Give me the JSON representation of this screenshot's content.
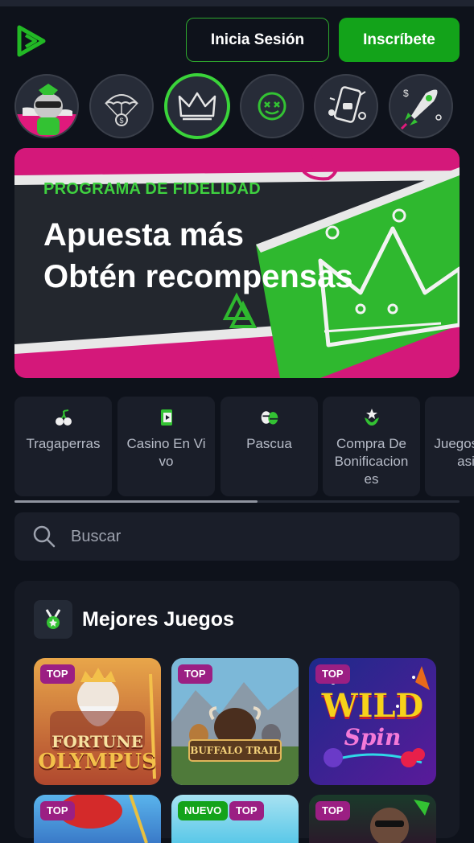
{
  "header": {
    "login_label": "Inicia Sesión",
    "signup_label": "Inscríbete",
    "accent": "#13a31a"
  },
  "stories": [
    {
      "name": "mascot-story",
      "icon": "green-mascot-icon"
    },
    {
      "name": "bonus-drop-story",
      "icon": "parachute-coin-icon"
    },
    {
      "name": "loyalty-story",
      "icon": "crown-icon",
      "active": true
    },
    {
      "name": "smiley-story",
      "icon": "green-face-icon"
    },
    {
      "name": "social-story",
      "icon": "phone-icon"
    },
    {
      "name": "crash-story",
      "icon": "rocket-icon"
    }
  ],
  "banner": {
    "kicker": "PROGRAMA DE FIDELIDAD",
    "line1": "Apuesta más",
    "line2": "Obtén recompensas"
  },
  "categories": [
    {
      "label": "Tragaperras",
      "icon": "cherries-icon"
    },
    {
      "label": "Casino En Vivo",
      "icon": "live-play-icon"
    },
    {
      "label": "Pascua",
      "icon": "easter-egg-icon"
    },
    {
      "label": "Compra De Bonificaciones",
      "icon": "star-shield-icon"
    },
    {
      "label": "Juegos De Casino",
      "icon": "cards-icon"
    }
  ],
  "search": {
    "placeholder": "Buscar"
  },
  "top_games": {
    "title": "Mejores Juegos",
    "icon": "medal-icon",
    "games": [
      {
        "title_line1": "FORTUNE",
        "title_line2": "OLYMPUS",
        "badges": [
          "TOP"
        ]
      },
      {
        "title_line1": "BUFFALO TRAIL",
        "badges": [
          "TOP"
        ]
      },
      {
        "title_line1": "WILD",
        "title_line2": "Spin",
        "badges": [
          "TOP"
        ]
      },
      {
        "badges": [
          "TOP"
        ]
      },
      {
        "badges": [
          "NUEVO",
          "TOP"
        ]
      },
      {
        "badges": [
          "TOP"
        ]
      }
    ]
  }
}
